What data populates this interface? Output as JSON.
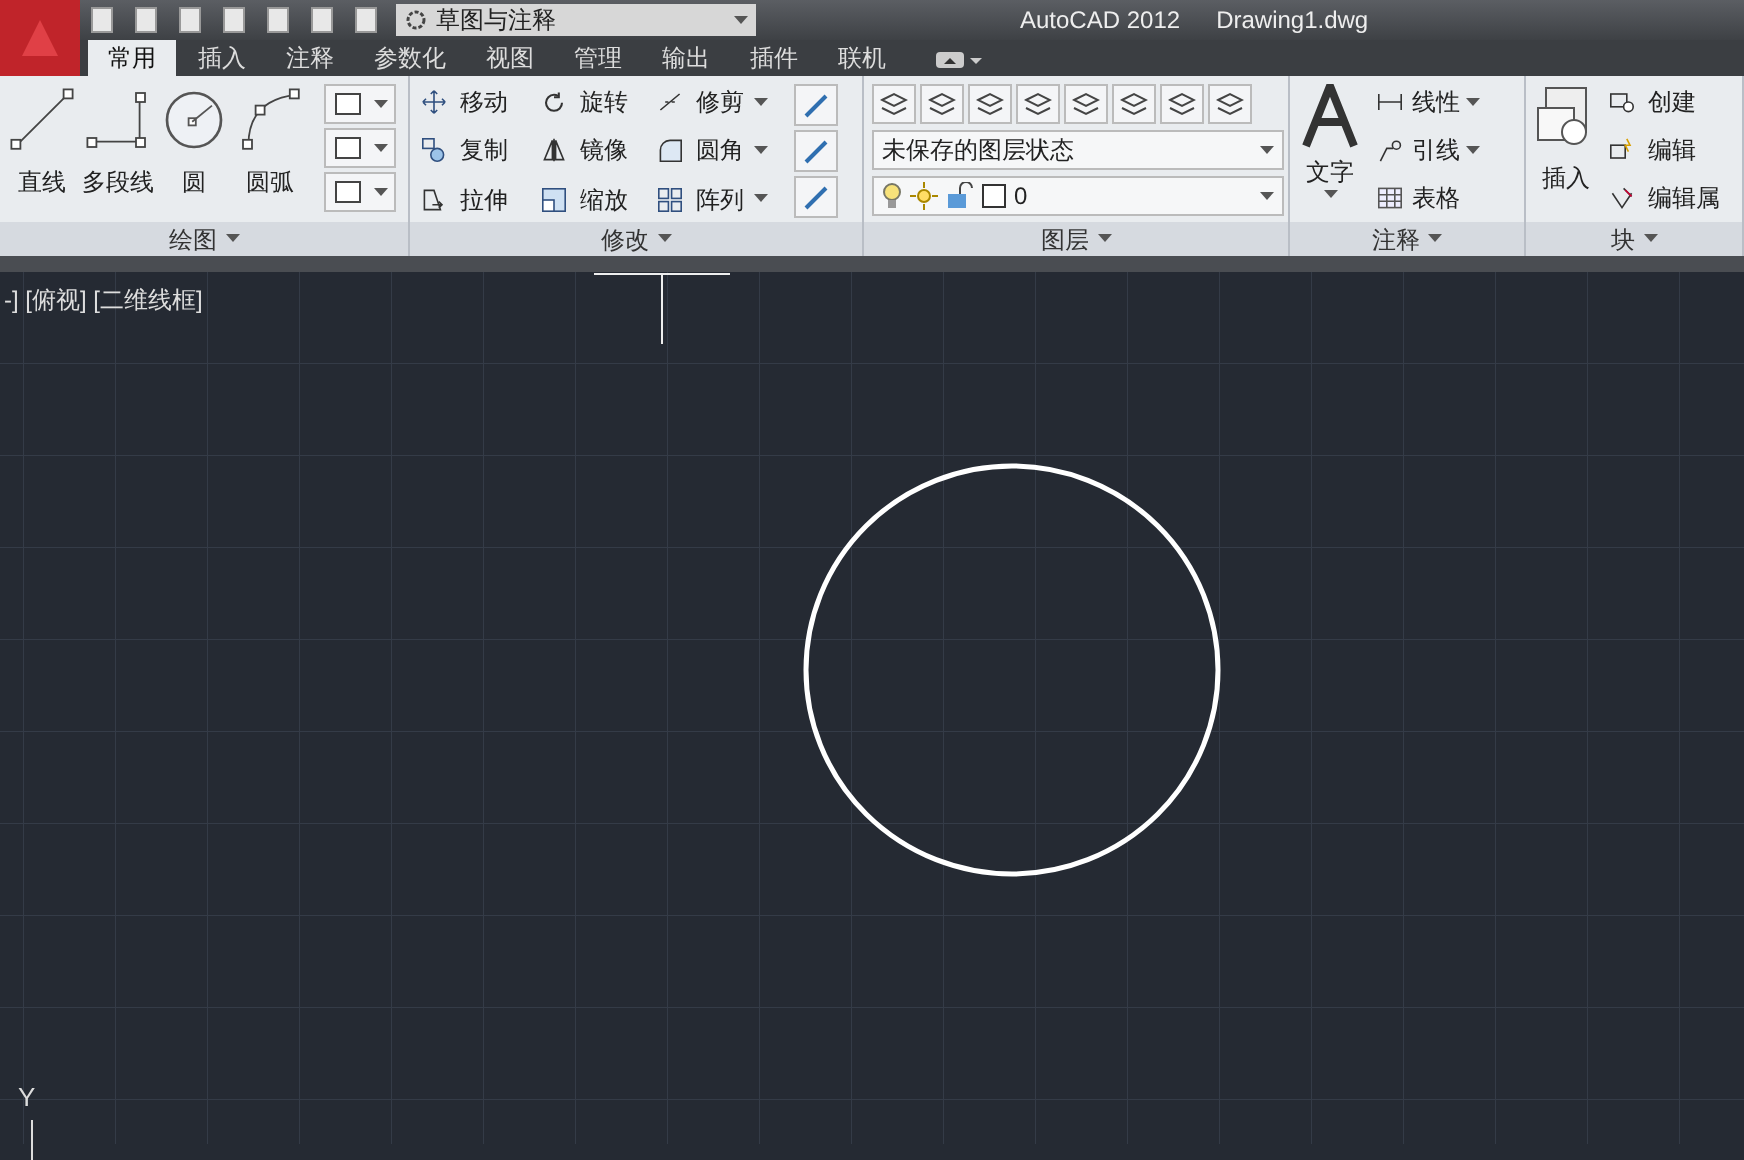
{
  "title_bar": {
    "workspace": "草图与注释",
    "app_title": "AutoCAD 2012",
    "file": "Drawing1.dwg"
  },
  "tabs": [
    {
      "label": "常用",
      "selected": true
    },
    {
      "label": "插入",
      "selected": false
    },
    {
      "label": "注释",
      "selected": false
    },
    {
      "label": "参数化",
      "selected": false
    },
    {
      "label": "视图",
      "selected": false
    },
    {
      "label": "管理",
      "selected": false
    },
    {
      "label": "输出",
      "selected": false
    },
    {
      "label": "插件",
      "selected": false
    },
    {
      "label": "联机",
      "selected": false
    }
  ],
  "draw_panel": {
    "title": "绘图",
    "tools": [
      {
        "kind": "line",
        "label": "直线"
      },
      {
        "kind": "polyline",
        "label": "多段线"
      },
      {
        "kind": "circle",
        "label": "圆"
      },
      {
        "kind": "arc",
        "label": "圆弧"
      }
    ]
  },
  "modify_panel": {
    "title": "修改",
    "tools": [
      {
        "kind": "move",
        "label": "移动",
        "has_menu": false
      },
      {
        "kind": "rotate",
        "label": "旋转",
        "has_menu": false
      },
      {
        "kind": "trim",
        "label": "修剪",
        "has_menu": true
      },
      {
        "kind": "copy",
        "label": "复制",
        "has_menu": false
      },
      {
        "kind": "mirror",
        "label": "镜像",
        "has_menu": false
      },
      {
        "kind": "fillet",
        "label": "圆角",
        "has_menu": true
      },
      {
        "kind": "stretch",
        "label": "拉伸",
        "has_menu": false
      },
      {
        "kind": "scale",
        "label": "缩放",
        "has_menu": false
      },
      {
        "kind": "array",
        "label": "阵列",
        "has_menu": true
      }
    ]
  },
  "layers_panel": {
    "title": "图层",
    "state_dropdown": "未保存的图层状态",
    "layer_dropdown": "0"
  },
  "annotation_panel": {
    "title": "注释",
    "big_tool": "文字",
    "tools": [
      {
        "kind": "linear",
        "label": "线性",
        "has_menu": true
      },
      {
        "kind": "leader",
        "label": "引线",
        "has_menu": true
      },
      {
        "kind": "table",
        "label": "表格",
        "has_menu": false
      }
    ]
  },
  "block_panel": {
    "title": "块",
    "big_tool": "插入",
    "tools": [
      {
        "kind": "create",
        "label": "创建"
      },
      {
        "kind": "edit",
        "label": "编辑"
      },
      {
        "kind": "attribute",
        "label": "编辑属"
      }
    ]
  },
  "viewport": {
    "label": "-] [俯视] [二维线框]",
    "axis_label": "Y"
  }
}
